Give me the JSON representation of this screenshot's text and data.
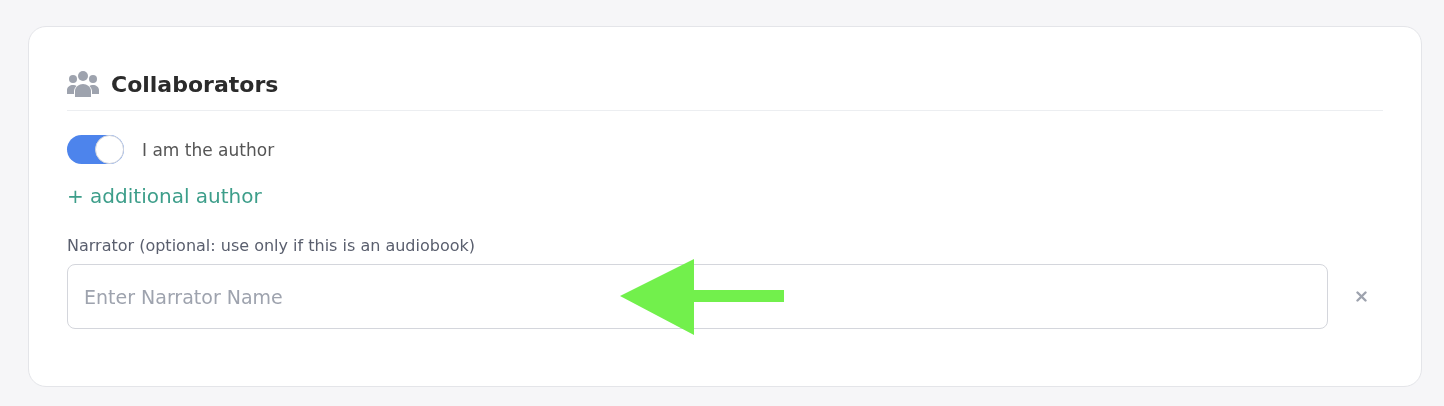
{
  "section": {
    "title": "Collaborators"
  },
  "author_toggle": {
    "label": "I am the author",
    "on": true
  },
  "add_author_link": "+ additional author",
  "narrator": {
    "label": "Narrator (optional: use only if this is an audiobook)",
    "placeholder": "Enter Narrator Name"
  }
}
